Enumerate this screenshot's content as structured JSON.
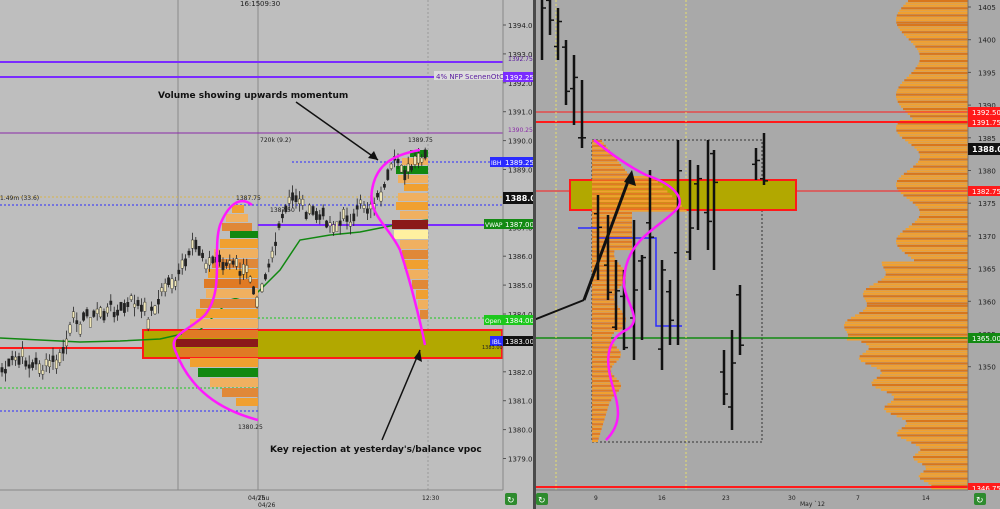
{
  "left_chart": {
    "top_time_labels": [
      "16:15",
      "09:30"
    ],
    "price_ticks": [
      "1394.00",
      "1393.00",
      "1392.00",
      "1391.00",
      "1390.00",
      "1389.00",
      "1388.00",
      "1387.00",
      "1386.00",
      "1385.00",
      "1384.00",
      "1383.00",
      "1382.00",
      "1381.00",
      "1380.00",
      "1379.00"
    ],
    "level_tags": {
      "top_line": "1392.75",
      "nfp": "4% NFP ScenenOtCrime",
      "nfp_price": "1392.25",
      "level_1390": "1390.25",
      "ibh": "IBH",
      "ibh_price": "1389.25",
      "current": "1388.00",
      "vwap": "VWAP",
      "vwap_price": "1387.00",
      "open": "Open",
      "open_price": "1384.00",
      "ibl": "IBL",
      "ibl_price": "1383.00"
    },
    "profile_labels": {
      "hi_vol": "720k (9.2)",
      "high_price": "1389.75",
      "side_vol": "1.49m (33.6)",
      "p1387": "1387.75",
      "p1387b": "1387.50",
      "low_price": "1380.25",
      "small_right": "1383.00"
    },
    "annotation_top": "Volume showing upwards momentum",
    "annotation_bottom": "Key rejection at yesterday's/balance vpoc",
    "date_labels": [
      "Thu",
      "04/26",
      "04/25",
      "12:30"
    ]
  },
  "right_chart": {
    "price_ticks": [
      "1405",
      "1400",
      "1395",
      "1390",
      "1385",
      "1380",
      "1375",
      "1370",
      "1365",
      "1360",
      "1355",
      "1350"
    ],
    "level_tags": {
      "r1": "1392.50",
      "r2": "1391.75",
      "current": "1388.00",
      "r3": "1382.75",
      "vpoc": "1365.00",
      "bottom": "1346.75"
    },
    "date_labels": [
      "9",
      "16",
      "23",
      "30",
      "May `12",
      "7",
      "14"
    ]
  },
  "colors": {
    "magenta": "#ff19ff",
    "purple": "#7a2bff",
    "red": "#ff1a1a",
    "green": "#138a13",
    "orange": "#f08a18",
    "yellow_zone": "#b2a800"
  }
}
